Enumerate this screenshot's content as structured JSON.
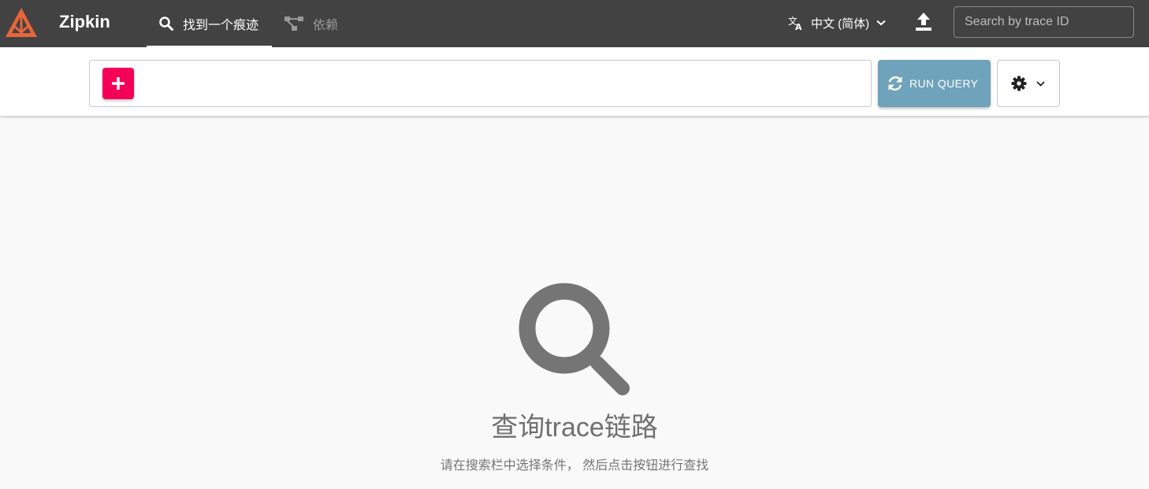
{
  "header": {
    "brand": "Zipkin",
    "tabs": [
      {
        "label": "找到一个痕迹",
        "icon": "search-icon",
        "active": true
      },
      {
        "label": "依赖",
        "icon": "dependency-graph-icon",
        "active": false
      }
    ],
    "language": {
      "label": "中文 (简体)",
      "icon": "translate-icon"
    },
    "upload_icon": "upload-icon",
    "trace_search": {
      "placeholder": "Search by trace ID",
      "value": ""
    }
  },
  "query_bar": {
    "add_icon": "plus-icon",
    "run_query_label": "RUN QUERY",
    "run_icon": "refresh-icon",
    "settings_icon": "gear-icon"
  },
  "empty_state": {
    "icon": "search-icon",
    "title": "查询trace链路",
    "subtitle": "请在搜索栏中选择条件， 然后点击按钮进行查找"
  },
  "colors": {
    "appbar": "#424242",
    "logo_orange": "#e8653a",
    "add_button": "#f50057",
    "run_button": "#6fa3bb",
    "background": "#f9f9f9"
  }
}
